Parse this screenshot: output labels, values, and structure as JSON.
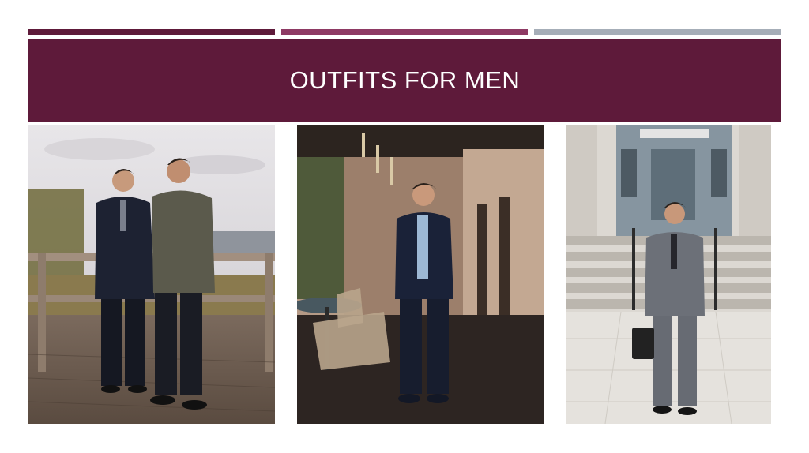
{
  "slide": {
    "title": "OUTFITS FOR MEN"
  },
  "colors": {
    "header_band": "#5e1a3a",
    "accent_bar_1": "#5e1a3a",
    "accent_bar_2": "#8e3a64",
    "accent_bar_3": "#a6aeb8"
  },
  "photos": [
    {
      "name": "two-men-in-suits-on-boardwalk"
    },
    {
      "name": "man-in-navy-suit-on-porch"
    },
    {
      "name": "man-in-grey-suit-with-briefcase"
    }
  ]
}
